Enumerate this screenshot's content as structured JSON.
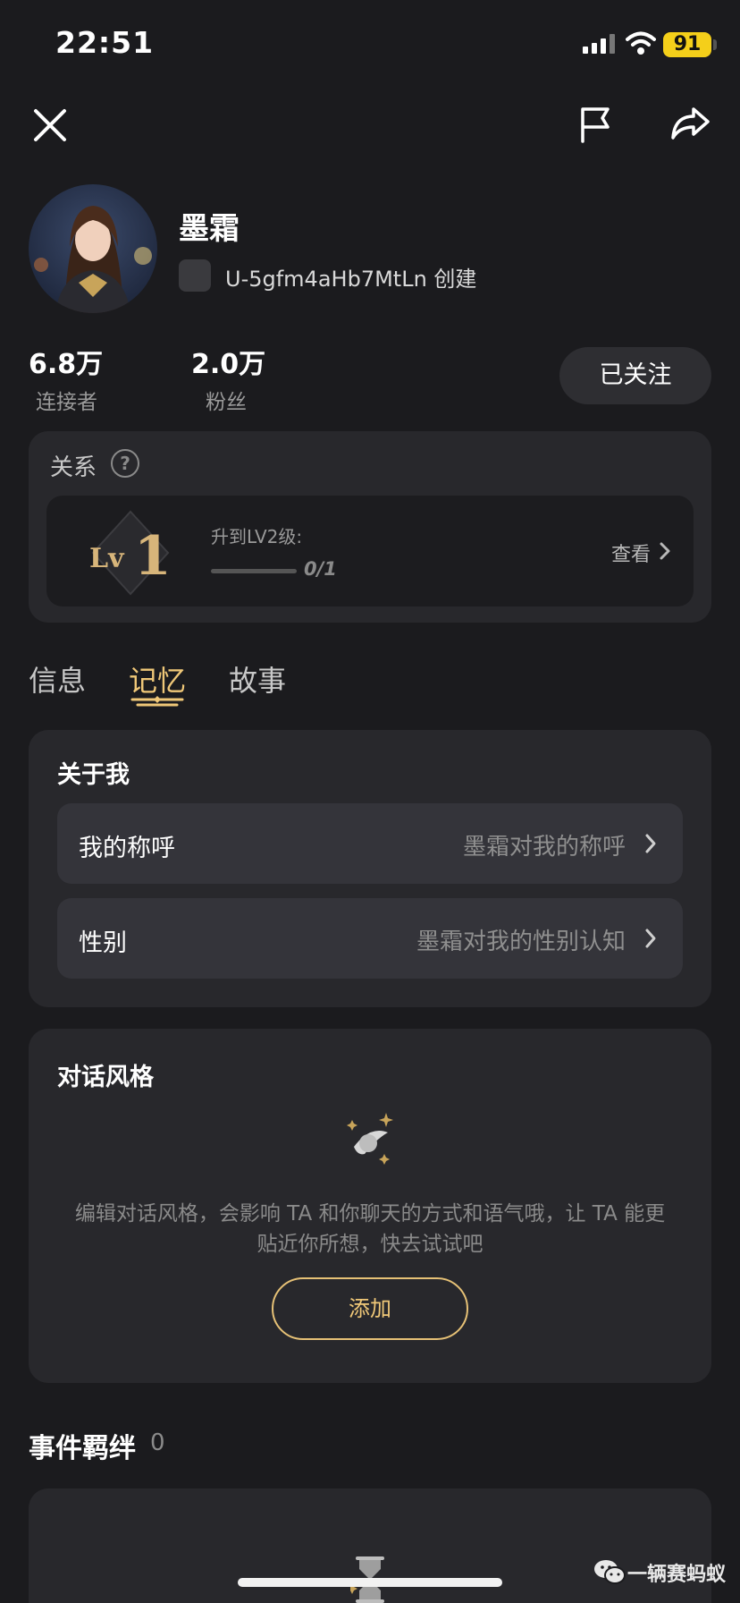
{
  "status_bar": {
    "time": "22:51",
    "battery": "91"
  },
  "profile": {
    "name": "墨霜",
    "creator": "U-5gfm4aHb7MtLn 创建",
    "stats": [
      {
        "value": "6.8万",
        "label": "连接者"
      },
      {
        "value": "2.0万",
        "label": "粉丝"
      }
    ],
    "follow_label": "已关注"
  },
  "relationship": {
    "title": "关系",
    "help": "?",
    "level_prefix": "Lv",
    "level_number": "1",
    "upgrade_text": "升到LV2级:",
    "progress_fraction": 0,
    "progress_count": "0/1",
    "view_label": "查看"
  },
  "tabs": [
    {
      "label": "信息",
      "active": false
    },
    {
      "label": "记忆",
      "active": true
    },
    {
      "label": "故事",
      "active": false
    }
  ],
  "about": {
    "title": "关于我",
    "rows": [
      {
        "label": "我的称呼",
        "value": "墨霜对我的称呼"
      },
      {
        "label": "性别",
        "value": "墨霜对我的性别认知"
      }
    ]
  },
  "dialog_style": {
    "title": "对话风格",
    "desc_line1": "编辑对话风格，会影响 TA 和你聊天的方式和语气哦，让 TA 能更",
    "desc_line2": "贴近你所想，快去试试吧",
    "add_label": "添加"
  },
  "events": {
    "title": "事件羁绊",
    "count": "0"
  },
  "watermark": "一辆赛蚂蚁",
  "colors": {
    "background": "#1b1b1e",
    "card": "#28282c",
    "accent": "#f0c878",
    "battery": "#f4cf1a"
  }
}
